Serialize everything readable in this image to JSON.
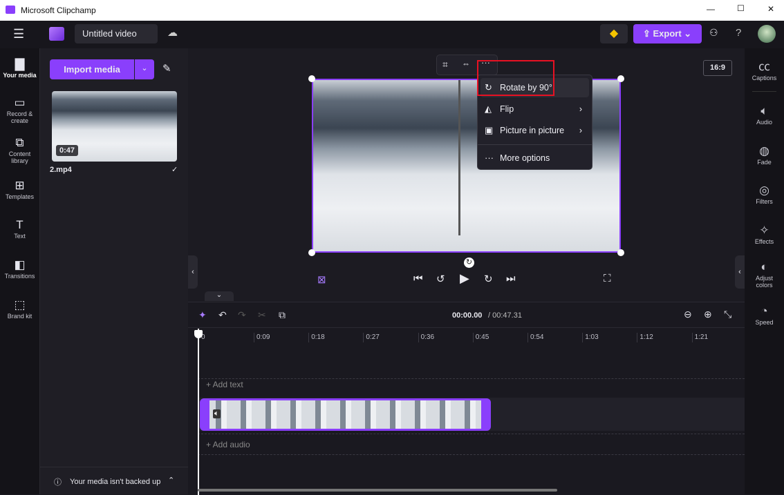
{
  "window": {
    "title": "Microsoft Clipchamp",
    "minimize": "—",
    "maximize": "☐",
    "close": "✕"
  },
  "appbar": {
    "project_name": "Untitled video",
    "export_label": "Export",
    "help": "?"
  },
  "leftnav": [
    {
      "label": "Your media",
      "icon": "folder-icon"
    },
    {
      "label": "Record & create",
      "icon": "camera-icon"
    },
    {
      "label": "Content library",
      "icon": "library-icon"
    },
    {
      "label": "Templates",
      "icon": "templates-icon"
    },
    {
      "label": "Text",
      "icon": "text-icon"
    },
    {
      "label": "Transitions",
      "icon": "transitions-icon"
    },
    {
      "label": "Brand kit",
      "icon": "brand-kit-icon"
    }
  ],
  "media": {
    "import_label": "Import media",
    "items": [
      {
        "name": "2.mp4",
        "duration": "0:47"
      }
    ],
    "backup_notice": "Your media isn't backed up"
  },
  "preview": {
    "aspect_ratio": "16:9"
  },
  "context_menu": [
    {
      "label": "Rotate by 90°",
      "submenu": false
    },
    {
      "label": "Flip",
      "submenu": true
    },
    {
      "label": "Picture in picture",
      "submenu": true
    },
    {
      "label": "More options",
      "submenu": false
    }
  ],
  "rightbar": [
    {
      "label": "Captions"
    },
    {
      "label": "Audio"
    },
    {
      "label": "Fade"
    },
    {
      "label": "Filters"
    },
    {
      "label": "Effects"
    },
    {
      "label": "Adjust colors"
    },
    {
      "label": "Speed"
    }
  ],
  "timeline": {
    "current_time": "00:00.00",
    "total_time": "/ 00:47.31",
    "ticks": [
      "0",
      "0:09",
      "0:18",
      "0:27",
      "0:36",
      "0:45",
      "0:54",
      "1:03",
      "1:12",
      "1:21"
    ],
    "add_text": "+ Add text",
    "add_audio": "+ Add audio"
  },
  "colors": {
    "accent": "#8a3ffc",
    "highlight_box": "#e81123"
  }
}
